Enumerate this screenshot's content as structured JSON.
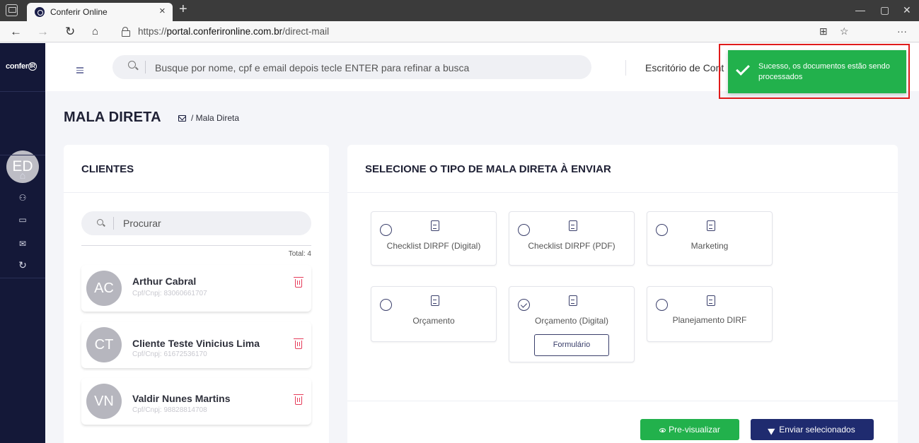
{
  "browser": {
    "tab_title": "Conferir Online",
    "tab_close": "×",
    "new_tab": "+",
    "url_scheme": "https://",
    "url_host": "portal.conferironline.com.br",
    "url_path": "/direct-mail",
    "more": "···",
    "minimize": "—",
    "maximize": "▢",
    "close": "✕"
  },
  "sidebar": {
    "logo": "confer",
    "logo_mark": "IR",
    "avatar": "ED",
    "icons": [
      "home-icon",
      "users-icon",
      "card-icon",
      "mail-icon",
      "refresh-icon"
    ]
  },
  "header": {
    "search_placeholder": "Busque por nome, cpf e email depois tecle ENTER para refinar a busca",
    "office": "Escritório de Cont"
  },
  "page": {
    "title": "MALA DIRETA",
    "breadcrumb": "/ Mala Direta"
  },
  "clients": {
    "title": "CLIENTES",
    "search_placeholder": "Procurar",
    "total": "Total: 4",
    "items": [
      {
        "initials": "AC",
        "name": "Arthur Cabral",
        "doc": "Cpf/Cnpj: 83060661707"
      },
      {
        "initials": "CT",
        "name": "Cliente Teste Vinicius Lima",
        "doc": "Cpf/Cnpj: 61672536170"
      },
      {
        "initials": "VN",
        "name": "Valdir Nunes Martins",
        "doc": "Cpf/Cnpj: 98828814708"
      }
    ]
  },
  "mail_types": {
    "title": "SELECIONE O TIPO DE MALA DIRETA À ENVIAR",
    "options": [
      {
        "label": "Checklist DIRPF (Digital)",
        "selected": false
      },
      {
        "label": "Checklist DIRPF (PDF)",
        "selected": false
      },
      {
        "label": "Marketing",
        "selected": false
      },
      {
        "label": "Orçamento",
        "selected": false
      },
      {
        "label": "Orçamento (Digital)",
        "selected": true,
        "button": "Formulário"
      },
      {
        "label": "Planejamento DIRF",
        "selected": false
      }
    ],
    "preview_label": "Pre-visualizar",
    "send_label": "Enviar selecionados"
  },
  "toast": {
    "message": "Sucesso, os documentos estão sendo processados",
    "color": "#22b14c"
  },
  "colors": {
    "sidebar": "#141838",
    "primary": "#1f2b6f",
    "success": "#22b14c",
    "danger": "#e63c5a"
  }
}
